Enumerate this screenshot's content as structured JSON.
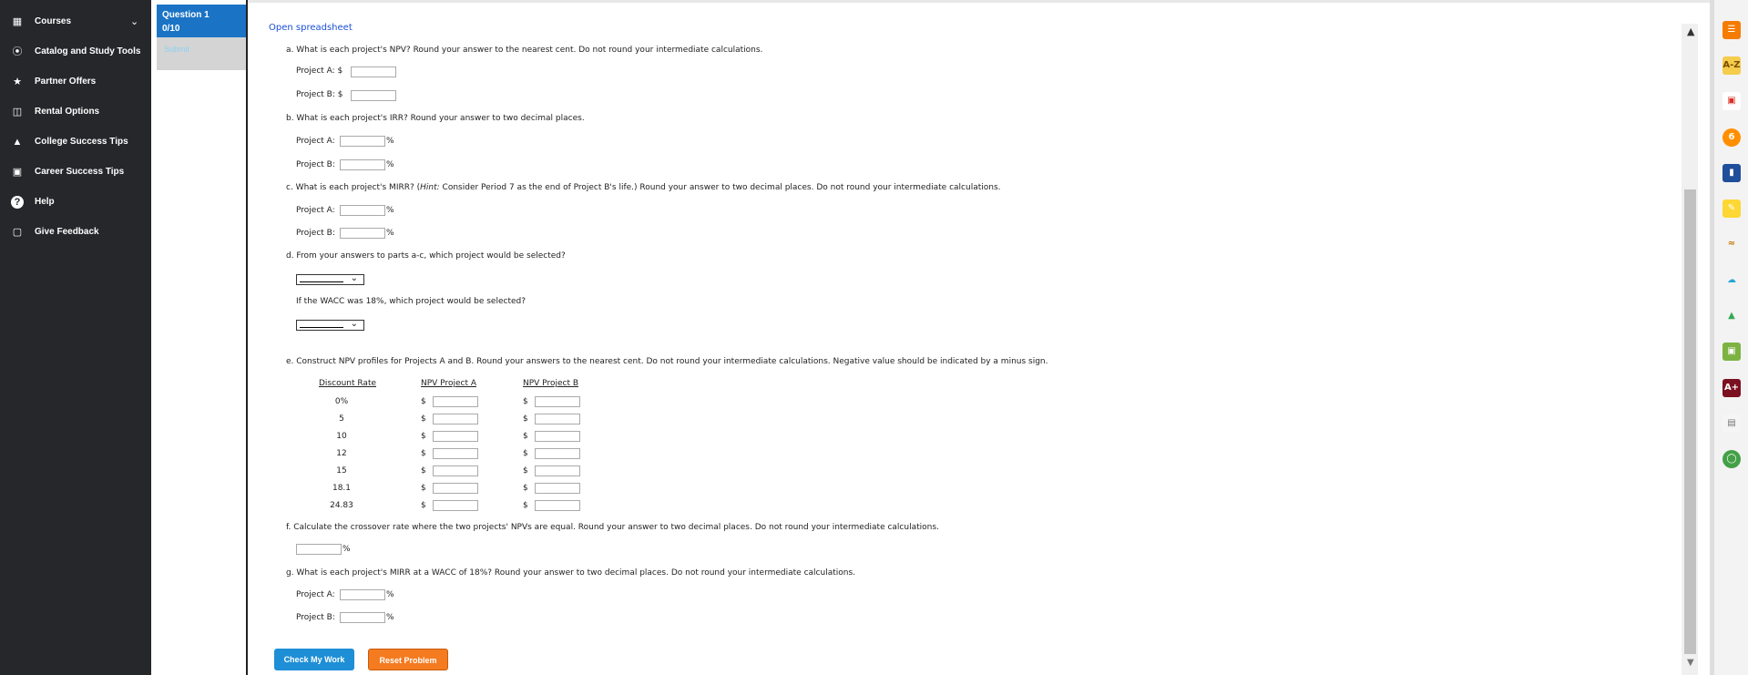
{
  "nav": {
    "items": [
      {
        "label": "Courses",
        "icon": "book-icon"
      },
      {
        "label": "Catalog and Study Tools",
        "icon": "compass-icon"
      },
      {
        "label": "Partner Offers",
        "icon": "star-icon"
      },
      {
        "label": "Rental Options",
        "icon": "open-book-icon"
      },
      {
        "label": "College Success Tips",
        "icon": "graduation-cap-icon"
      },
      {
        "label": "Career Success Tips",
        "icon": "briefcase-icon"
      },
      {
        "label": "Help",
        "icon": "question-icon"
      },
      {
        "label": "Give Feedback",
        "icon": "feedback-icon"
      }
    ]
  },
  "question_panel": {
    "title": "Question 1",
    "score": "0/10",
    "submit": "Submit"
  },
  "content": {
    "open_spreadsheet": "Open spreadsheet",
    "a": {
      "prompt": "a. What is each project's NPV? Round your answer to the nearest cent. Do not round your intermediate calculations.",
      "project_a": "Project A: $",
      "project_b": "Project B: $"
    },
    "b": {
      "prompt": "b. What is each project's IRR? Round your answer to two decimal places.",
      "project_a": "Project A:",
      "project_b": "Project B:"
    },
    "c": {
      "prompt_pre": "c. What is each project's MIRR? (",
      "hint": "Hint:",
      "prompt_post": " Consider Period 7 as the end of Project B's life.) Round your answer to two decimal places. Do not round your intermediate calculations.",
      "project_a": "Project A:",
      "project_b": "Project B:"
    },
    "d": {
      "prompt": "d. From your answers to parts a-c, which project would be selected?",
      "prompt2": "If the WACC was 18%, which project would be selected?"
    },
    "e": {
      "prompt": "e. Construct NPV profiles for Projects A and B. Round your answers to the nearest cent. Do not round your intermediate calculations. Negative value should be indicated by a minus sign.",
      "headers": [
        "Discount Rate",
        "NPV Project A",
        "NPV Project B"
      ],
      "rates": [
        "0%",
        "5",
        "10",
        "12",
        "15",
        "18.1",
        "24.83"
      ],
      "currency": "$"
    },
    "f": {
      "prompt": "f. Calculate the crossover rate where the two projects' NPVs are equal. Round your answer to two decimal places. Do not round your intermediate calculations."
    },
    "g": {
      "prompt": "g. What is each project's MIRR at a WACC of 18%? Round your answer to two decimal places. Do not round your intermediate calculations.",
      "project_a": "Project A:",
      "project_b": "Project B:"
    },
    "percent": "%",
    "buttons": {
      "check": "Check My Work",
      "reset": "Reset Problem"
    }
  },
  "extensions": {
    "items": [
      {
        "icon": "rss-icon",
        "label": ""
      },
      {
        "icon": "a-z-icon",
        "label": "A-Z"
      },
      {
        "icon": "office-icon",
        "label": ""
      },
      {
        "icon": "number-six-icon",
        "label": "6"
      },
      {
        "icon": "blue-book-icon",
        "label": ""
      },
      {
        "icon": "notepad-icon",
        "label": ""
      },
      {
        "icon": "sound-wave-icon",
        "label": ""
      },
      {
        "icon": "cloud-icon",
        "label": ""
      },
      {
        "icon": "drive-icon",
        "label": ""
      },
      {
        "icon": "cart-icon",
        "label": ""
      },
      {
        "icon": "a-plus-icon",
        "label": "A+"
      },
      {
        "icon": "note-icon",
        "label": ""
      },
      {
        "icon": "ring-icon",
        "label": ""
      }
    ]
  }
}
